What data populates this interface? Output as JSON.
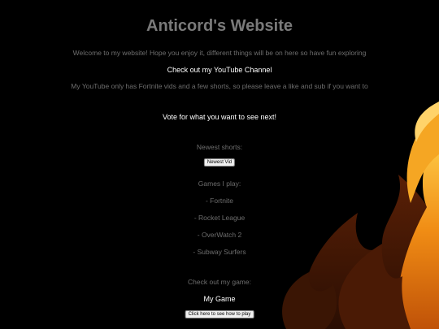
{
  "header": {
    "title": "Anticord's Website"
  },
  "intro": {
    "welcome": "Welcome to my website! Hope you enjoy it, different things will be on here so have fun exploring"
  },
  "youtube": {
    "link_label": "Check out my YouTube Channel",
    "note": "My YouTube only has Fortnite vids and a few shorts, so please leave a like and sub if you want to"
  },
  "vote": {
    "link_label": "Vote for what you want to see next!"
  },
  "shorts": {
    "heading": "Newest shorts:",
    "button_label": "Newest Vid"
  },
  "games": {
    "heading": "Games I play:",
    "items": [
      "- Fortnite",
      "- Rocket League",
      "- OverWatch 2",
      "- Subway Surfers"
    ]
  },
  "my_game": {
    "heading": "Check out my game:",
    "title": "My Game",
    "button_label": "Click here to see how to play"
  },
  "colors": {
    "background": "#000000",
    "muted_text": "#6e6e6e",
    "flame_orange": "#f39a1a",
    "flame_dark": "#8a3a08"
  }
}
